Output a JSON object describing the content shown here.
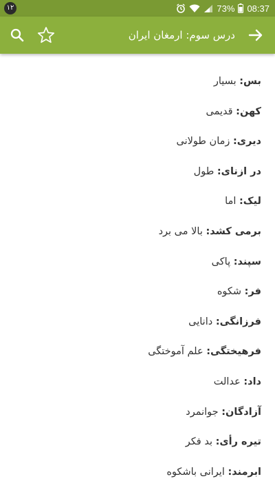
{
  "status_bar": {
    "notification_count": "۱۲",
    "battery_percent": "73%",
    "time": "08:37"
  },
  "app_bar": {
    "title": "درس سوم: ارمغان ایران",
    "icons": [
      "search-icon",
      "star-outline-icon",
      "arrow-forward-icon"
    ]
  },
  "vocabulary": [
    {
      "term": "بس:",
      "definition": " بسیار"
    },
    {
      "term": "کهن:",
      "definition": " قدیمی"
    },
    {
      "term": "دیری:",
      "definition": " زمان طولانی"
    },
    {
      "term": "در ازنای:",
      "definition": " طول"
    },
    {
      "term": "لیک:",
      "definition": " اما"
    },
    {
      "term": "برمی کشد:",
      "definition": " بالا می برد"
    },
    {
      "term": "سپند:",
      "definition": " پاکی"
    },
    {
      "term": "فر:",
      "definition": " شکوه"
    },
    {
      "term": "فرزانگی:",
      "definition": " دانایی"
    },
    {
      "term": "فرهیختگی:",
      "definition": " علم آموختگی"
    },
    {
      "term": "داد:",
      "definition": " عدالت"
    },
    {
      "term": "آزادگان:",
      "definition": " جوانمرد"
    },
    {
      "term": "تیره رأی:",
      "definition": " بد فکر"
    },
    {
      "term": "ابرمند:",
      "definition": " ایرانی باشکوه"
    }
  ],
  "colors": {
    "status_bar": "#7a9a33",
    "app_bar": "#8cb03d",
    "text": "#333333",
    "background": "#ffffff"
  }
}
